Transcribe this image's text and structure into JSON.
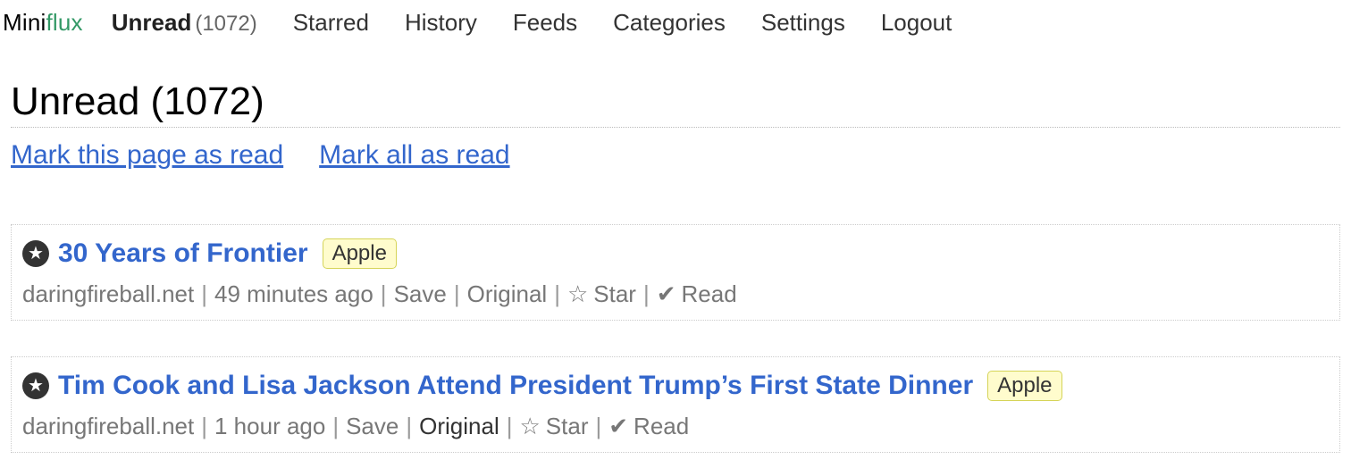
{
  "header": {
    "logo_mini": "Mini",
    "logo_flux": "flux",
    "nav": {
      "unread_label": "Unread",
      "unread_count": "(1072)",
      "starred": "Starred",
      "history": "History",
      "feeds": "Feeds",
      "categories": "Categories",
      "settings": "Settings",
      "logout": "Logout"
    }
  },
  "page": {
    "title": "Unread (1072)",
    "actions": {
      "mark_page_read": "Mark this page as read",
      "mark_all_read": "Mark all as read"
    }
  },
  "items": [
    {
      "title": "30 Years of Frontier",
      "category": "Apple",
      "site": "daringfireball.net",
      "time": "49 minutes ago",
      "save": "Save",
      "original": "Original",
      "star_glyph": "☆",
      "star": "Star",
      "read_glyph": "✔",
      "read": "Read"
    },
    {
      "title": "Tim Cook and Lisa Jackson Attend President Trump’s First State Dinner",
      "category": "Apple",
      "site": "daringfireball.net",
      "time": "1 hour ago",
      "save": "Save",
      "original": "Original",
      "star_glyph": "☆",
      "star": "Star",
      "read_glyph": "✔",
      "read": "Read"
    }
  ],
  "icons": {
    "item_badge": "★"
  },
  "colors": {
    "link": "#3366cc",
    "logo_accent": "#339966",
    "category_bg": "#fffccd",
    "category_border": "#d5d458"
  }
}
